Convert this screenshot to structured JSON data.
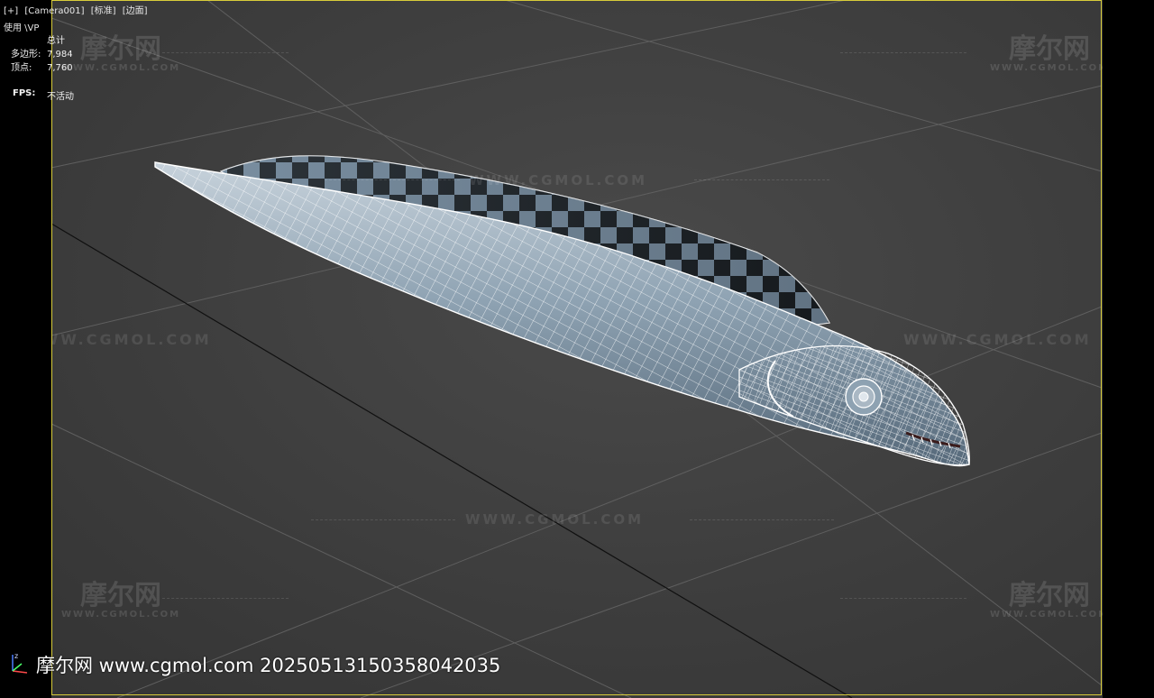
{
  "viewport": {
    "menu": [
      "[+]",
      "[Camera001]",
      "[标准]",
      "[边面]"
    ],
    "sub_label": "使用 \\VP"
  },
  "stats": {
    "header": "总计",
    "polygons_label": "多边形:",
    "polygons_value": "7,984",
    "vertices_label": "顶点:",
    "vertices_value": "7,760",
    "fps_label": "FPS:",
    "fps_value": "不活动"
  },
  "watermarks": {
    "url": "WWW.CGMOL.COM",
    "logo": "摩尔网",
    "logo_sub": "WWW.CGMOL.COM"
  },
  "footer": {
    "text": "摩尔网 www.cgmol.com 20250513150358042035"
  },
  "colors": {
    "safe_frame": "#d8cc3a",
    "wire": "#ffffff",
    "body": "#8fa3b3"
  },
  "icons": {
    "axis": "axis-tripod-icon"
  }
}
